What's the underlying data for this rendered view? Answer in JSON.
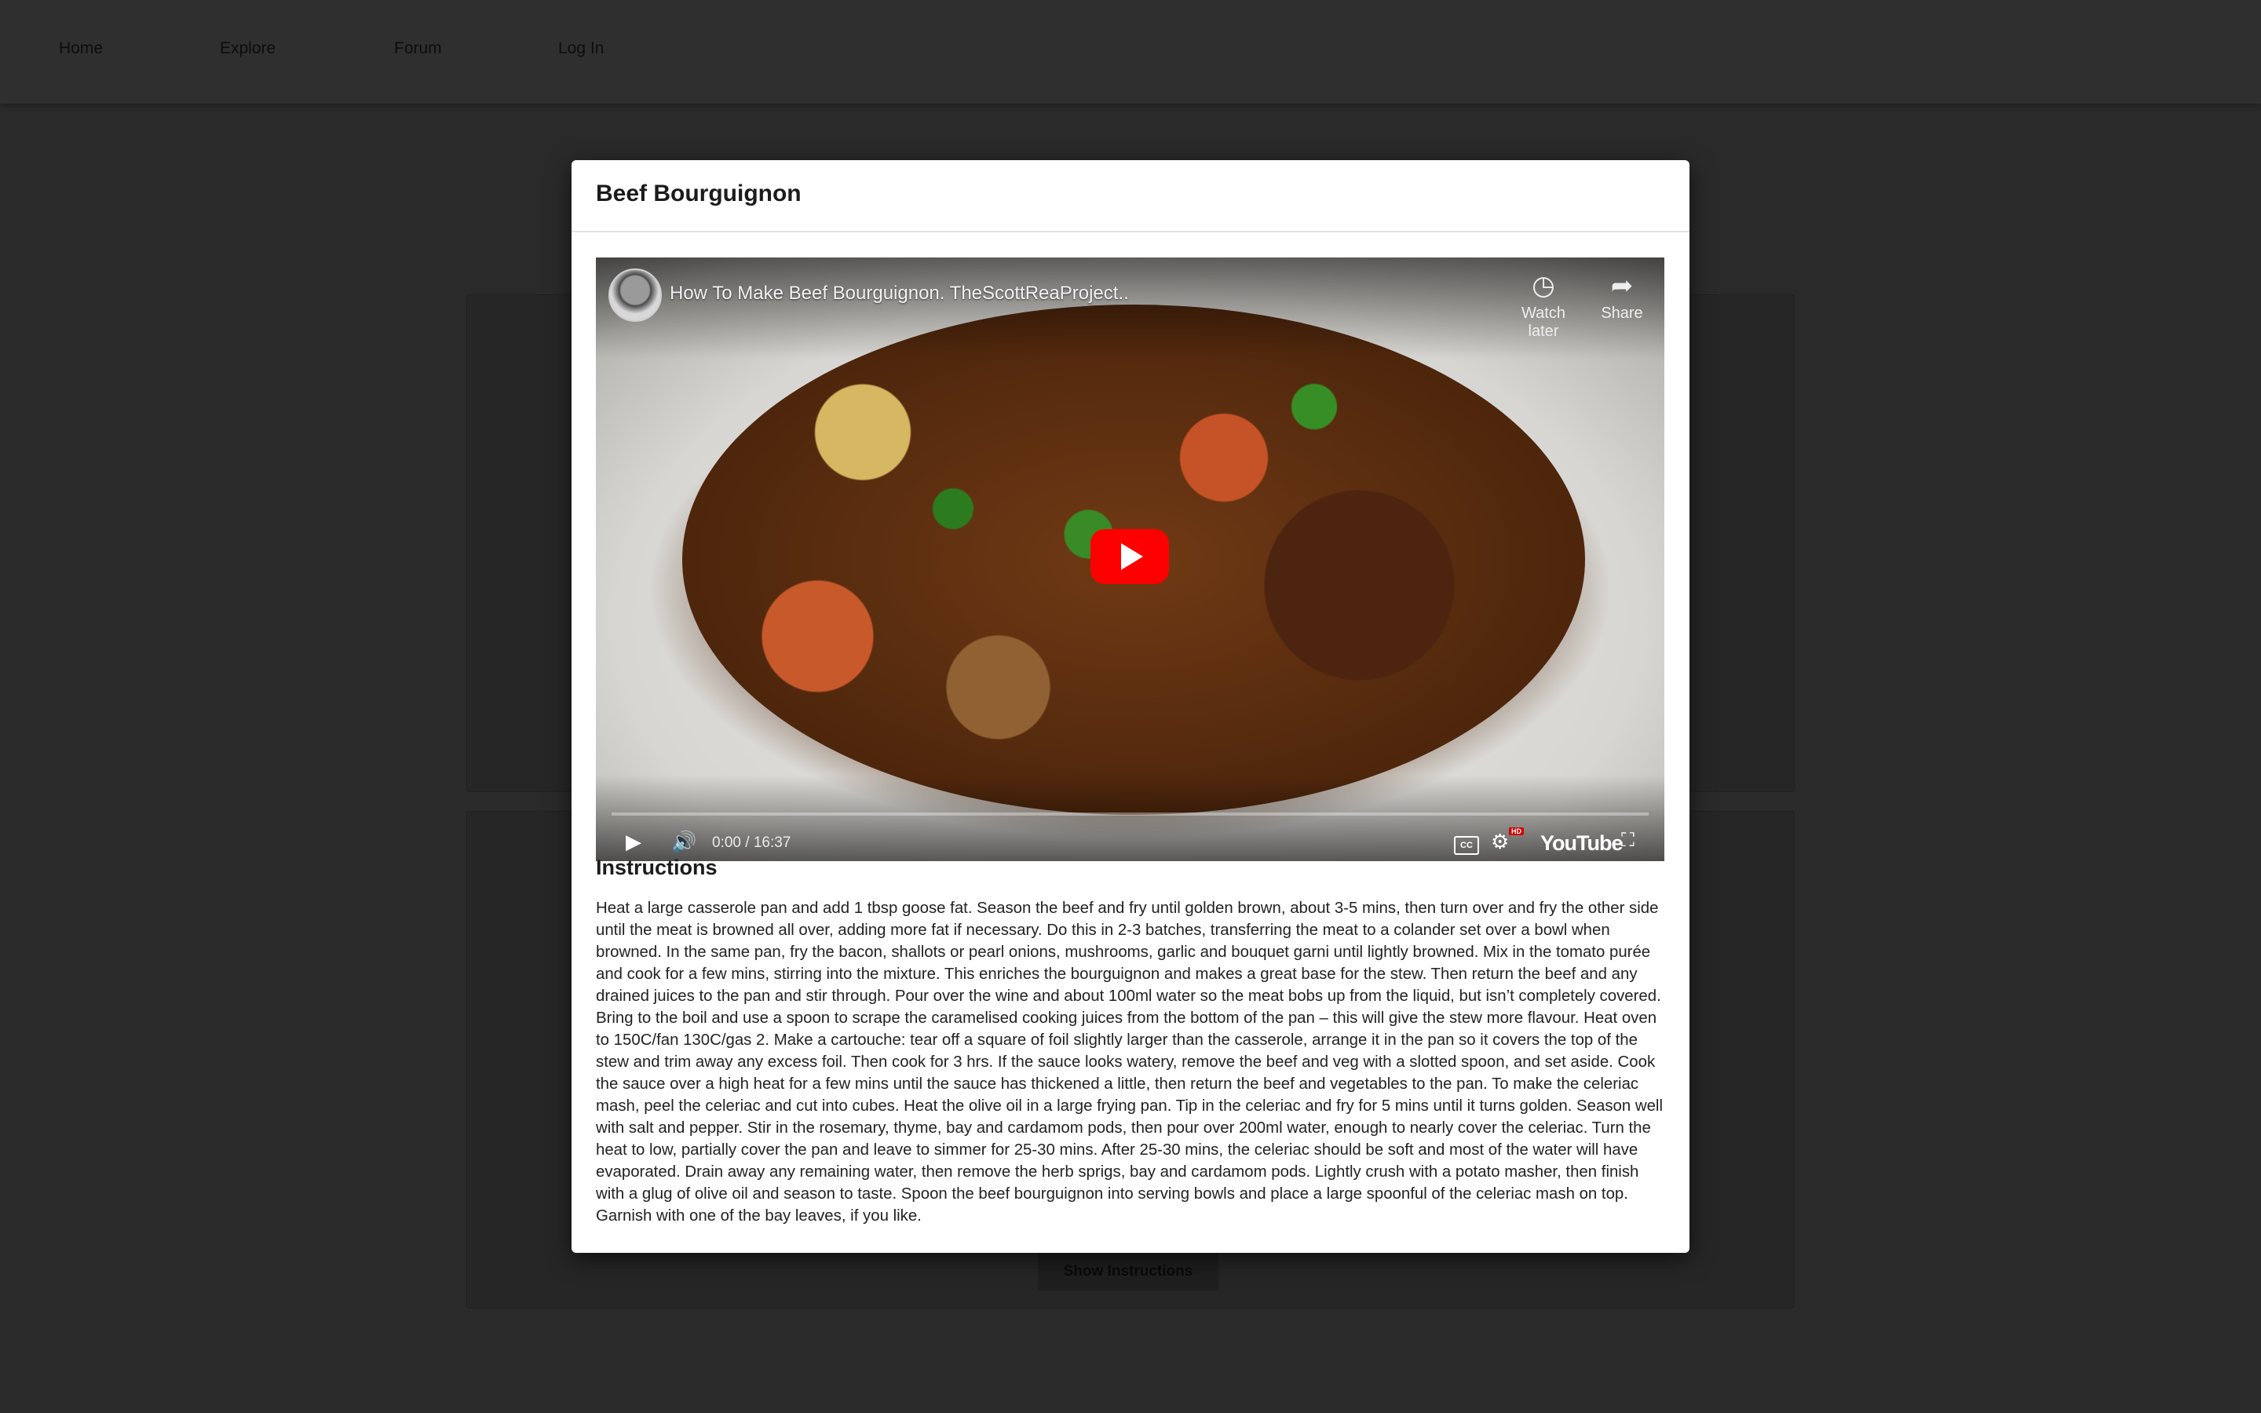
{
  "nav": {
    "home": "Home",
    "explore": "Explore",
    "forum": "Forum",
    "login": "Log In"
  },
  "background": {
    "show_instructions": "Show Instructions"
  },
  "modal": {
    "title": "Beef Bourguignon",
    "video": {
      "title": "How To Make Beef Bourguignon. TheScottReaProject..",
      "watch_later": "Watch later",
      "share": "Share",
      "time": "0:00 / 16:37",
      "cc_label": "CC",
      "hd_label": "HD",
      "logo": "YouTube",
      "progress": 0
    },
    "instructions_heading": "Instructions",
    "instructions": "Heat a large casserole pan and add 1 tbsp goose fat. Season the beef and fry until golden brown, about 3-5 mins, then turn over and fry the other side until the meat is browned all over, adding more fat if necessary. Do this in 2-3 batches, transferring the meat to a colander set over a bowl when browned. In the same pan, fry the bacon, shallots or pearl onions, mushrooms, garlic and bouquet garni until lightly browned. Mix in the tomato purée and cook for a few mins, stirring into the mixture. This enriches the bourguignon and makes a great base for the stew. Then return the beef and any drained juices to the pan and stir through. Pour over the wine and about 100ml water so the meat bobs up from the liquid, but isn’t completely covered. Bring to the boil and use a spoon to scrape the caramelised cooking juices from the bottom of the pan – this will give the stew more flavour. Heat oven to 150C/fan 130C/gas 2. Make a cartouche: tear off a square of foil slightly larger than the casserole, arrange it in the pan so it covers the top of the stew and trim away any excess foil. Then cook for 3 hrs. If the sauce looks watery, remove the beef and veg with a slotted spoon, and set aside. Cook the sauce over a high heat for a few mins until the sauce has thickened a little, then return the beef and vegetables to the pan. To make the celeriac mash, peel the celeriac and cut into cubes. Heat the olive oil in a large frying pan. Tip in the celeriac and fry for 5 mins until it turns golden. Season well with salt and pepper. Stir in the rosemary, thyme, bay and cardamom pods, then pour over 200ml water, enough to nearly cover the celeriac. Turn the heat to low, partially cover the pan and leave to simmer for 25-30 mins. After 25-30 mins, the celeriac should be soft and most of the water will have evaporated. Drain away any remaining water, then remove the herb sprigs, bay and cardamom pods. Lightly crush with a potato masher, then finish with a glug of olive oil and season to taste. Spoon the beef bourguignon into serving bowls and place a large spoonful of the celeriac mash on top. Garnish with one of the bay leaves, if you like."
  }
}
